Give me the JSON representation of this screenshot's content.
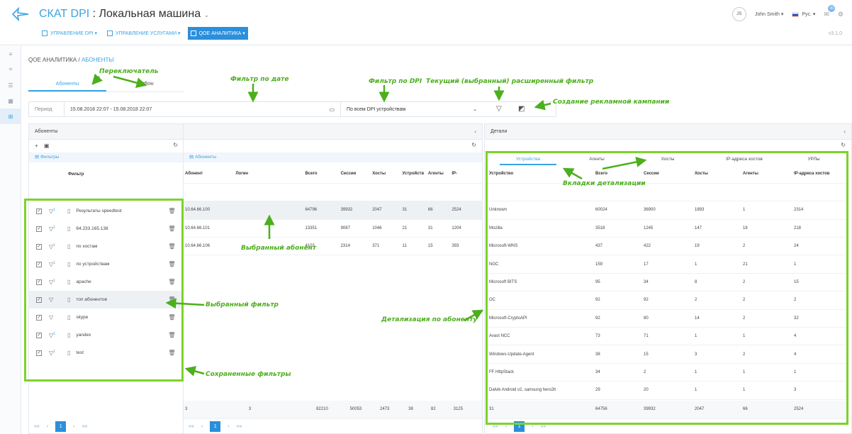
{
  "header": {
    "brand": "СКАТ DPI",
    "separator": " : ",
    "machine": "Локальная машина",
    "nav": [
      {
        "label": "УПРАВЛЕНИЕ DPI ▾"
      },
      {
        "label": "УПРАВЛЕНИЕ УСЛУГАМИ ▾"
      },
      {
        "label": "QOE АНАЛИТИКА ▾"
      }
    ],
    "user_initials": "JS",
    "user_name": "John Smith ▾",
    "language": "Рус. ▾",
    "notifications_count": "30",
    "version": "v3.1.0"
  },
  "breadcrumb": {
    "section": "QOE АНАЛИТИКА / ",
    "page": "АБОНЕНТЫ"
  },
  "switcher": {
    "tab1": "Абоненты",
    "tab2": "Netflow"
  },
  "filterbar": {
    "period_label": "Период",
    "period_value": "15.08.2018 22:07 - 15.08.2018 22:07",
    "dpi_select": "По всем DPI устройствам"
  },
  "annotations": {
    "switcher": "Переключатель",
    "date_filter": "Фильтр по дате",
    "dpi_filter": "Фильтр по DPI",
    "current_filter": "Текущий (выбранный) расширенный фильтр",
    "ad_campaign": "Создание рекламной кампании",
    "selected_subscriber": "Выбранный абонент",
    "selected_filter": "Выбранный фильтр",
    "saved_filters": "Сохраненные фильтры",
    "detail_tabs": "Вкладки детализации",
    "detail_by_subscriber": "Детализация по абоненту"
  },
  "filters_panel": {
    "title": "Абоненты",
    "list_title": "Фильтры",
    "col_header": "Фильтр",
    "items": [
      {
        "name": "Результаты speedtest",
        "has_badge": true
      },
      {
        "name": "64.233.165.138",
        "has_badge": true
      },
      {
        "name": "по хостам",
        "has_badge": true
      },
      {
        "name": "по устройствам",
        "has_badge": true
      },
      {
        "name": "apache",
        "has_badge": true
      },
      {
        "name": "топ абонентов",
        "has_badge": false
      },
      {
        "name": "skype",
        "has_badge": false
      },
      {
        "name": "yandex",
        "has_badge": true
      },
      {
        "name": "test",
        "has_badge": true
      }
    ],
    "badge": "1"
  },
  "subscribers_panel": {
    "list_title": "Абоненты",
    "columns": [
      "Абонент",
      "Логин",
      "Всего",
      "Сессии",
      "Хосты",
      "Устройств",
      "Агенты",
      "IP-"
    ],
    "rows": [
      [
        "10.64.66.100",
        "",
        "64796",
        "39932",
        "2047",
        "31",
        "66",
        "2524"
      ],
      [
        "10.64.66.101",
        "",
        "13351",
        "9087",
        "1046",
        "21",
        "31",
        "1204"
      ],
      [
        "10.64.66.106",
        "",
        "4103",
        "2314",
        "371",
        "11",
        "15",
        "393"
      ]
    ],
    "totals": [
      "3",
      "3",
      "82210",
      "50053",
      "2473",
      "38",
      "82",
      "3125"
    ]
  },
  "details_panel": {
    "title": "Детали",
    "tabs": [
      "Устройства",
      "Агенты",
      "Хосты",
      "IP-адреса хостов",
      "УРЛы"
    ],
    "columns": [
      "Устройство",
      "Всего",
      "Сессии",
      "Хосты",
      "Агенты",
      "IP-адреса хостов"
    ],
    "rows": [
      [
        "Unknown",
        "60024",
        "36900",
        "1893",
        "1",
        "2314"
      ],
      [
        "Mozilla",
        "3518",
        "1245",
        "147",
        "18",
        "218"
      ],
      [
        "Microsoft-WNS",
        "437",
        "422",
        "19",
        "2",
        "24"
      ],
      [
        "NGC",
        "159",
        "17",
        "1",
        "21",
        "1"
      ],
      [
        "Microsoft BITS",
        "95",
        "34",
        "8",
        "2",
        "15"
      ],
      [
        "OC",
        "92",
        "92",
        "2",
        "2",
        "2"
      ],
      [
        "Microsoft-CryptoAPI",
        "92",
        "80",
        "14",
        "2",
        "32"
      ],
      [
        "Avast NCC",
        "73",
        "71",
        "1",
        "1",
        "4"
      ],
      [
        "Windows-Update-Agent",
        "38",
        "15",
        "3",
        "2",
        "4"
      ],
      [
        "FF HttpStack",
        "34",
        "2",
        "1",
        "1",
        "1"
      ],
      [
        "Dalvik Android v2, samsung hero2lt",
        "29",
        "20",
        "1",
        "1",
        "3"
      ]
    ],
    "totals": [
      "31",
      "64756",
      "39932",
      "2047",
      "66",
      "2524"
    ]
  },
  "pager": {
    "first": "««",
    "prev": "‹",
    "current": "1",
    "next": "›",
    "last": "»»"
  },
  "colors": {
    "accent": "#2b8fdc",
    "annotation": "#4caf1c",
    "annotation_box": "#7bd32b"
  }
}
